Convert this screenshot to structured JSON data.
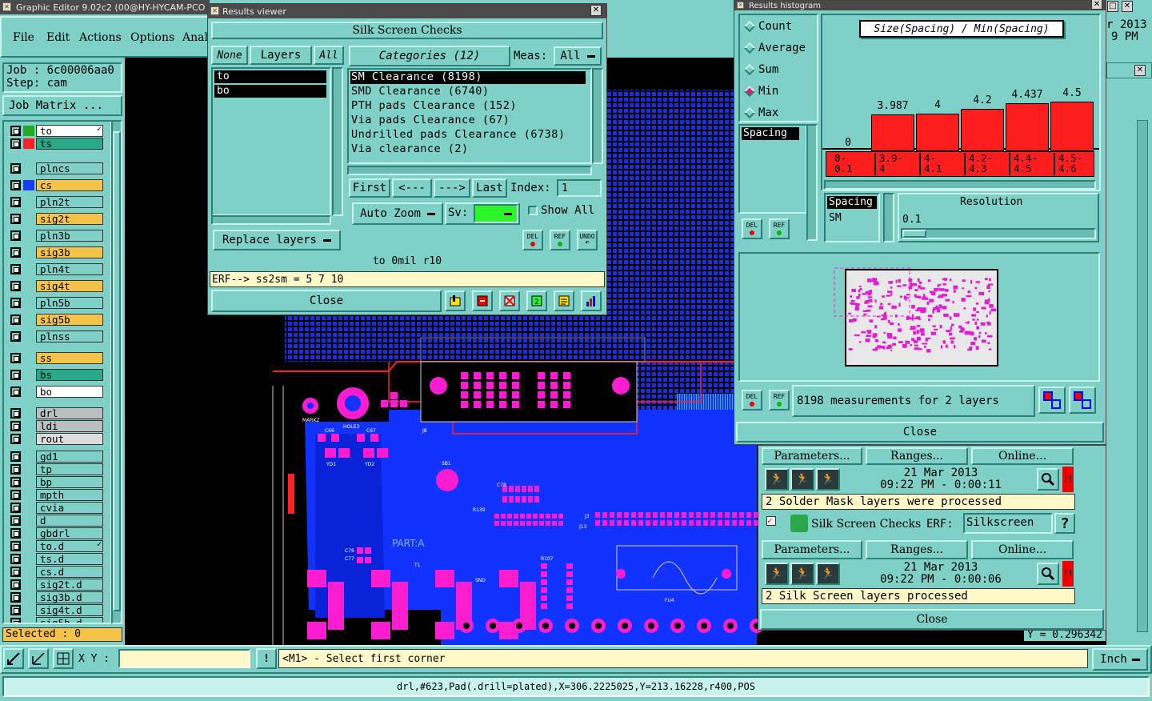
{
  "app": {
    "title": "Graphic Editor 9.02c2 (00@HY-HYCAM-PCO"
  },
  "menu": [
    "File",
    "Edit",
    "Actions",
    "Options",
    "Anal"
  ],
  "job": {
    "job_line": "Job : 6c00006aa0",
    "step_line": "Step: cam",
    "matrix_btn": "Job Matrix ..."
  },
  "layers": [
    {
      "name": "to",
      "color": "#22aa22",
      "fill": "#ffffff",
      "mark": "✓"
    },
    {
      "name": "ts",
      "color": "#ff2222",
      "fill": "#27a889",
      "mark": ""
    },
    {
      "name": "plncs",
      "color": "",
      "fill": "#7fd0c6",
      "mark": ""
    },
    {
      "name": "cs",
      "color": "#1a3cff",
      "fill": "#f5c34a",
      "mark": ""
    },
    {
      "name": "pln2t",
      "color": "",
      "fill": "#7fd0c6",
      "mark": ""
    },
    {
      "name": "sig2t",
      "color": "",
      "fill": "#f5c34a",
      "mark": ""
    },
    {
      "name": "pln3b",
      "color": "",
      "fill": "#7fd0c6",
      "mark": ""
    },
    {
      "name": "sig3b",
      "color": "",
      "fill": "#f5c34a",
      "mark": ""
    },
    {
      "name": "pln4t",
      "color": "",
      "fill": "#7fd0c6",
      "mark": ""
    },
    {
      "name": "sig4t",
      "color": "",
      "fill": "#f5c34a",
      "mark": ""
    },
    {
      "name": "pln5b",
      "color": "",
      "fill": "#7fd0c6",
      "mark": ""
    },
    {
      "name": "sig5b",
      "color": "",
      "fill": "#f5c34a",
      "mark": ""
    },
    {
      "name": "plnss",
      "color": "",
      "fill": "#7fd0c6",
      "mark": ""
    },
    {
      "name": "ss",
      "color": "",
      "fill": "#f5c34a",
      "mark": ""
    },
    {
      "name": "bs",
      "color": "",
      "fill": "#27a889",
      "mark": ""
    },
    {
      "name": "bo",
      "color": "",
      "fill": "#ffffff",
      "mark": ""
    },
    {
      "name": "drl",
      "color": "",
      "fill": "#b9c0c0",
      "mark": ""
    },
    {
      "name": "ldi",
      "color": "",
      "fill": "#b9c0c0",
      "mark": ""
    },
    {
      "name": "rout",
      "color": "",
      "fill": "#dcdcdc",
      "mark": ""
    },
    {
      "name": "gd1",
      "color": "",
      "fill": "#7fd0c6",
      "mark": ""
    },
    {
      "name": "tp",
      "color": "",
      "fill": "#7fd0c6",
      "mark": ""
    },
    {
      "name": "bp",
      "color": "",
      "fill": "#7fd0c6",
      "mark": ""
    },
    {
      "name": "mpth",
      "color": "",
      "fill": "#7fd0c6",
      "mark": ""
    },
    {
      "name": "cvia",
      "color": "",
      "fill": "#7fd0c6",
      "mark": ""
    },
    {
      "name": "d",
      "color": "",
      "fill": "#7fd0c6",
      "mark": ""
    },
    {
      "name": "gbdrl",
      "color": "",
      "fill": "#7fd0c6",
      "mark": ""
    },
    {
      "name": "to.d",
      "color": "",
      "fill": "#7fd0c6",
      "mark": "✓"
    },
    {
      "name": "ts.d",
      "color": "",
      "fill": "#7fd0c6",
      "mark": ""
    },
    {
      "name": "cs.d",
      "color": "",
      "fill": "#7fd0c6",
      "mark": ""
    },
    {
      "name": "sig2t.d",
      "color": "",
      "fill": "#7fd0c6",
      "mark": ""
    },
    {
      "name": "sig3b.d",
      "color": "",
      "fill": "#7fd0c6",
      "mark": ""
    },
    {
      "name": "sig4t.d",
      "color": "",
      "fill": "#7fd0c6",
      "mark": ""
    },
    {
      "name": "sig5b.d",
      "color": "",
      "fill": "#7fd0c6",
      "mark": ""
    },
    {
      "name": "ss.d",
      "color": "",
      "fill": "#7fd0c6",
      "mark": ""
    },
    {
      "name": "bs.d",
      "color": "",
      "fill": "#7fd0c6",
      "mark": ""
    }
  ],
  "selected": "Selected : 0",
  "bottom": {
    "xy_label": "X Y :",
    "xy_value": "",
    "prompt": "<M1> - Select first corner",
    "units": "Inch",
    "status": "drl,#623,Pad(.drill=plated),X=306.2225025,Y=213.16228,r400,POS"
  },
  "rv": {
    "title": "Results viewer",
    "header": "Silk Screen Checks",
    "none": "None",
    "layers_lbl": "Layers",
    "all": "All",
    "layer_list": [
      "to",
      "bo"
    ],
    "categories": "Categories (12)",
    "meas": "Meas:",
    "meas_value": "All",
    "checks": [
      "SM Clearance (8198)",
      "SMD Clearance (6740)",
      "PTH pads Clearance (152)",
      "Via pads Clearance (67)",
      "Undrilled pads Clearance (6738)",
      "Via clearance (2)"
    ],
    "first": "First",
    "prev": "<---",
    "next": "--->",
    "last": "Last",
    "index_lbl": "Index:",
    "index_val": "1",
    "auto_zoom": "Auto Zoom",
    "sv": "Sv:",
    "show_all": "Show All",
    "replace": "Replace layers",
    "del": "DEL",
    "ref": "REF",
    "undo": "UNDO",
    "info": "to 0mil  r10",
    "erf": "ERF--> ss2sm = 5 7 10",
    "close": "Close"
  },
  "rh": {
    "title": "Results histogram",
    "options": [
      "Count",
      "Average",
      "Sum",
      "Min",
      "Max"
    ],
    "selected": "Min",
    "chart_title": "Size(Spacing) / Min(Spacing)",
    "spacing_list": [
      "Spacing"
    ],
    "del": "DEL",
    "ref": "REF",
    "spacing_box": "Spacing",
    "sm": "SM",
    "resolution": "Resolution",
    "resolution_val": "0.1",
    "measurements": "8198 measurements for 2 layers",
    "close": "Close"
  },
  "chart_data": {
    "type": "bar",
    "title": "Size(Spacing) / Min(Spacing)",
    "categories": [
      "0-\n0.1",
      "3.9-\n4",
      "4-\n4.1",
      "4.2-\n4.3",
      "4.4-\n4.5",
      "4.5-\n4.6"
    ],
    "values": [
      0,
      3.987,
      4,
      4.2,
      4.437,
      4.5
    ],
    "value_labels": [
      "0",
      "3.987",
      "4",
      "4.2",
      "4.437",
      "4.5"
    ]
  },
  "bg": {
    "date_partial": "r 2013",
    "time_partial": "9 PM",
    "y_readout": "Y = 0.296342"
  },
  "ap": {
    "params": "Parameters...",
    "ranges": "Ranges...",
    "online": "Online...",
    "date1": "21 Mar 2013",
    "time1": "09:22 PM - 0:00:11",
    "msg1": "2 Solder Mask layers were processed",
    "check2": "Silk Screen Checks",
    "erf_lbl": "ERF:",
    "erf_val": "Silkscreen",
    "help": "?",
    "date2": "21 Mar 2013",
    "time2": "09:22 PM - 0:00:06",
    "msg2": "2 Silk Screen layers processed",
    "close": "Close"
  },
  "pcb": {
    "part": "PART:A",
    "hole": "HOLE3",
    "markz": "MARKZ",
    "j8": "J8",
    "j3": "J3",
    "j13": "J13",
    "t1": "T1",
    "sb1": "SB1",
    "snd": "SND",
    "fu4": "FU4",
    "c66": "C66",
    "c67": "C67",
    "yd1": "YD1",
    "yd2": "YD2",
    "c76": "C76",
    "c77": "C77",
    "r139": "R139",
    "c78": "C78",
    "r107": "R107"
  }
}
